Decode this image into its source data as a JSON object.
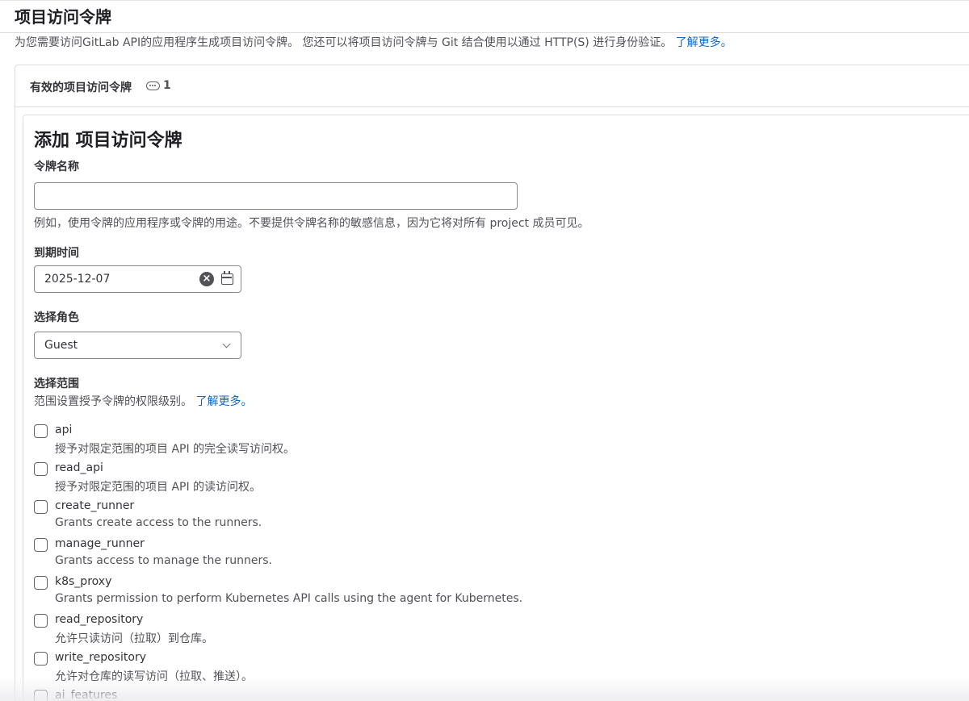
{
  "page": {
    "title": "项目访问令牌",
    "description": "为您需要访问GitLab API的应用程序生成项目访问令牌。 您还可以将项目访问令牌与 Git 结合使用以通过 HTTP(S) 进行身份验证。",
    "learn_more_label": "了解更多。"
  },
  "active_tokens": {
    "title": "有效的项目访问令牌",
    "count": "1",
    "icon": "token-icon"
  },
  "form": {
    "title": "添加 项目访问令牌",
    "token_name": {
      "label": "令牌名称",
      "value": "",
      "placeholder": "",
      "help": "例如，使用令牌的应用程序或令牌的用途。不要提供令牌名称的敏感信息，因为它将对所有 project 成员可见。"
    },
    "expiration": {
      "label": "到期时间",
      "value": "2025-12-07",
      "clear_icon": "clear-icon",
      "calendar_icon": "calendar-icon"
    },
    "role": {
      "label": "选择角色",
      "selected": "Guest",
      "icon": "chevron-down-icon"
    },
    "scopes": {
      "label": "选择范围",
      "help": "范围设置授予令牌的权限级别。",
      "learn_more_label": "了解更多。",
      "items": [
        {
          "name": "api",
          "description": "授予对限定范围的项目 API 的完全读写访问权。",
          "checked": false
        },
        {
          "name": "read_api",
          "description": "授予对限定范围的项目 API 的读访问权。",
          "checked": false
        },
        {
          "name": "create_runner",
          "description": "Grants create access to the runners.",
          "checked": false
        },
        {
          "name": "manage_runner",
          "description": "Grants access to manage the runners.",
          "checked": false
        },
        {
          "name": "k8s_proxy",
          "description": "Grants permission to perform Kubernetes API calls using the agent for Kubernetes.",
          "checked": false
        },
        {
          "name": "read_repository",
          "description": "允许只读访问（拉取）到仓库。",
          "checked": false
        },
        {
          "name": "write_repository",
          "description": "允许对仓库的读写访问（拉取、推送）。",
          "checked": false
        },
        {
          "name": "ai_features",
          "description": "",
          "checked": false
        }
      ]
    }
  },
  "colors": {
    "link": "#1068bf",
    "border": "#dcdcde",
    "text": "#333238",
    "muted_text": "#535158"
  }
}
